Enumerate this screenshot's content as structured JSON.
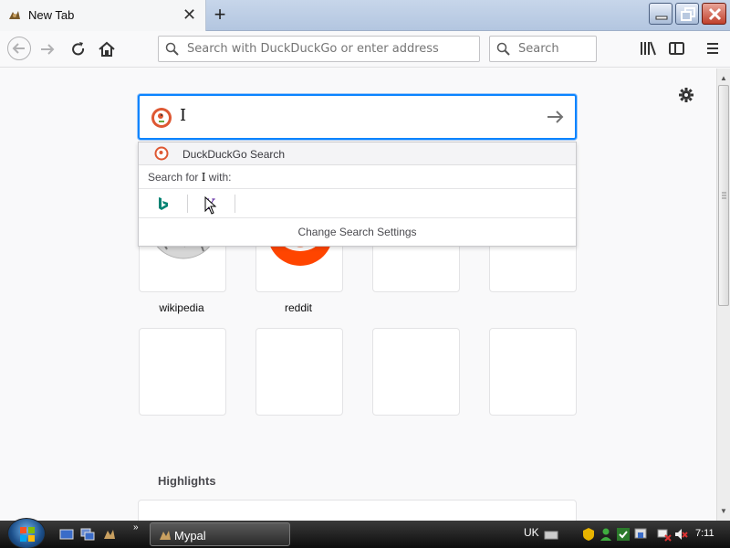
{
  "tab": {
    "title": "New Tab",
    "close_icon": "close-icon",
    "new_tab_icon": "plus-icon"
  },
  "toolbar": {
    "address_placeholder": "Search with DuckDuckGo or enter address",
    "search_placeholder": "Search"
  },
  "newtab": {
    "search_value": "I",
    "dropdown": {
      "suggestion_label": "DuckDuckGo Search",
      "search_for_prefix": "Search for ",
      "search_for_term": "I",
      "search_for_suffix": " with:",
      "change_settings": "Change Search Settings"
    },
    "topsites": [
      {
        "label": "wikipedia"
      },
      {
        "label": "reddit"
      },
      {
        "label": ""
      },
      {
        "label": ""
      },
      {
        "label": ""
      },
      {
        "label": ""
      },
      {
        "label": ""
      },
      {
        "label": ""
      }
    ],
    "highlights_title": "Highlights"
  },
  "taskbar": {
    "app_label": "Mypal",
    "language": "UK",
    "clock": "7:11"
  },
  "colors": {
    "accent": "#0a84ff",
    "reddit": "#ff4500",
    "bing": "#008373",
    "yahoo_purple": "#400090"
  }
}
